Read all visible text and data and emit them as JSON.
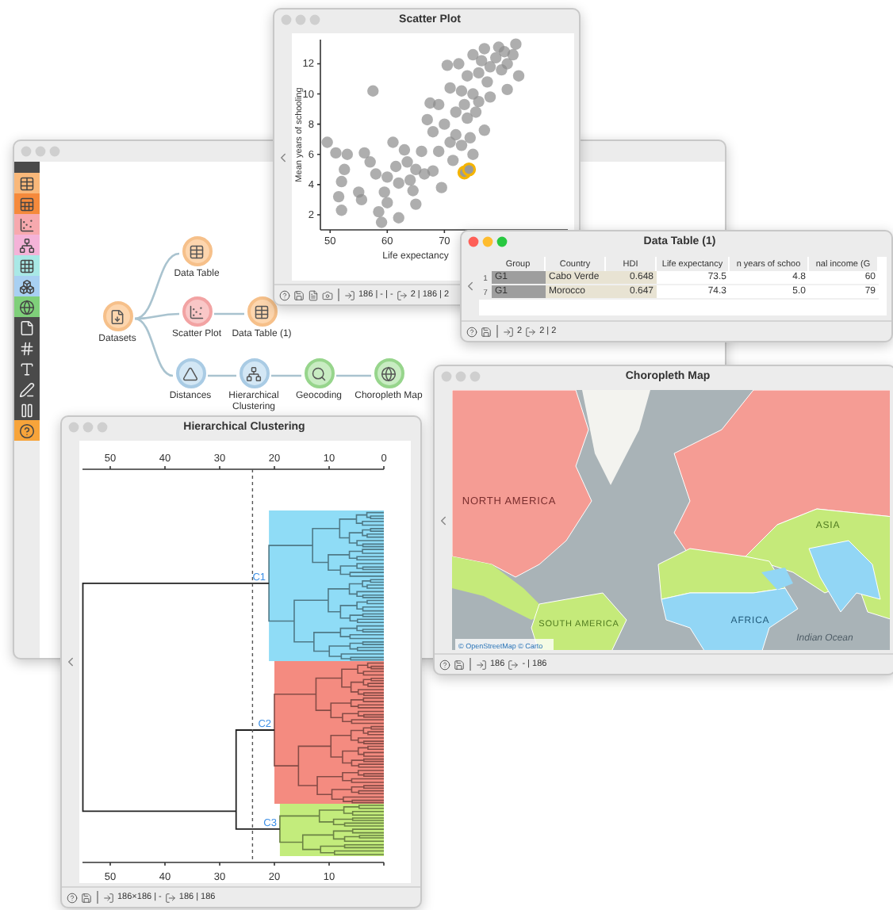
{
  "workflow": {
    "toolbar": [
      {
        "kind": "header"
      },
      {
        "kind": "table"
      },
      {
        "kind": "sheet"
      },
      {
        "kind": "scatter"
      },
      {
        "kind": "tree"
      },
      {
        "kind": "grid"
      },
      {
        "kind": "cluster"
      },
      {
        "kind": "globe"
      },
      {
        "kind": "file"
      },
      {
        "kind": "hash"
      },
      {
        "kind": "text"
      },
      {
        "kind": "pen"
      },
      {
        "kind": "pause"
      },
      {
        "kind": "help"
      }
    ],
    "nodes": [
      {
        "label": "Datasets",
        "kind": "file"
      },
      {
        "label": "Data Table",
        "kind": "table"
      },
      {
        "label": "Scatter Plot",
        "kind": "scatter"
      },
      {
        "label": "Data Table (1)",
        "kind": "table"
      },
      {
        "label": "Distances",
        "kind": "distance"
      },
      {
        "label": "Hierarchical Clustering",
        "kind": "hierarchy"
      },
      {
        "label": "Geocoding",
        "kind": "geocode"
      },
      {
        "label": "Choropleth Map",
        "kind": "map"
      }
    ]
  },
  "scatter_window": {
    "title": "Scatter Plot",
    "chart_data": {
      "type": "scatter",
      "xlabel": "Life expectancy",
      "ylabel": "Mean years of schooling",
      "xlim": [
        48.3,
        91.6
      ],
      "ylim": [
        1,
        13.6
      ],
      "xticks": [
        50,
        60,
        70
      ],
      "yticks": [
        2,
        4,
        6,
        8,
        10,
        12
      ],
      "x": [
        49.5,
        51,
        52.5,
        53,
        52,
        51.5,
        52,
        55,
        55.5,
        56,
        57,
        57.5,
        58,
        58.5,
        59,
        59.5,
        60,
        60,
        61,
        61.5,
        62,
        62,
        63,
        63.5,
        64,
        64.5,
        65,
        65,
        66,
        66.5,
        67,
        67.5,
        68,
        68,
        69,
        69,
        69.5,
        70,
        70.5,
        71,
        71,
        71.5,
        72,
        72,
        72.5,
        73,
        73,
        73.5,
        74,
        74,
        74.5,
        75,
        75,
        75.5,
        76,
        76,
        76.5,
        77,
        77.5,
        78,
        78,
        79,
        79.5,
        80,
        80.5,
        81,
        81,
        82,
        82.5,
        83,
        77,
        75,
        73.5,
        74.3
      ],
      "series": [
        {
          "color": "#8c8c8c",
          "values": [
            6.8,
            6.1,
            5,
            6,
            4.2,
            3.2,
            2.3,
            3.5,
            3,
            6.1,
            5.5,
            10.2,
            4.7,
            2.2,
            1.5,
            3.5,
            4.5,
            2.8,
            6.8,
            5.2,
            4.1,
            1.8,
            6.3,
            5.5,
            4.3,
            3.6,
            5,
            2.7,
            6.2,
            4.7,
            8.3,
            9.4,
            7.5,
            4.9,
            6.2,
            9.3,
            3.8,
            8,
            11.9,
            10.4,
            6.8,
            5.6,
            8.8,
            7.3,
            12,
            10.2,
            6.6,
            9.3,
            11.2,
            8.4,
            7.1,
            12.6,
            10,
            8.8,
            11.4,
            9.5,
            12.2,
            13,
            10.8,
            11.8,
            9.8,
            12.4,
            13.1,
            11.6,
            12.8,
            12,
            10.3,
            12.6,
            13.3,
            11.2,
            7.6,
            6,
            null,
            null
          ]
        },
        {
          "color": "#f5b400",
          "values": [
            null,
            null,
            null,
            null,
            null,
            null,
            null,
            null,
            null,
            null,
            null,
            null,
            null,
            null,
            null,
            null,
            null,
            null,
            null,
            null,
            null,
            null,
            null,
            null,
            null,
            null,
            null,
            null,
            null,
            null,
            null,
            null,
            null,
            null,
            null,
            null,
            null,
            null,
            null,
            null,
            null,
            null,
            null,
            null,
            null,
            null,
            null,
            null,
            null,
            null,
            null,
            null,
            null,
            null,
            null,
            null,
            null,
            null,
            null,
            null,
            null,
            null,
            null,
            null,
            null,
            null,
            null,
            null,
            null,
            null,
            null,
            null,
            4.8,
            5.0
          ]
        }
      ]
    },
    "status": [
      "186 | - | -",
      "2 | 186 | 2"
    ]
  },
  "table_window": {
    "title": "Data Table (1)",
    "columns": [
      "Group",
      "Country",
      "HDI",
      "Life expectancy",
      "n years of schoo",
      "nal income (G"
    ],
    "rows": [
      {
        "index": "1",
        "cells": [
          "G1",
          "Cabo Verde",
          "0.648",
          "73.5",
          "4.8",
          "60"
        ]
      },
      {
        "index": "7",
        "cells": [
          "G1",
          "Morocco",
          "0.647",
          "74.3",
          "5.0",
          "79"
        ]
      }
    ],
    "status": [
      "2",
      "2 | 2"
    ]
  },
  "map_window": {
    "title": "Choropleth Map",
    "labels": [
      "NORTH AMERICA",
      "ASIA",
      "AFRICA",
      "SOUTH AMERICA",
      "Indian Ocean"
    ],
    "attribution": "© OpenStreetMap © Carto",
    "status": [
      "186",
      "- | 186"
    ]
  },
  "clustering_window": {
    "title": "Hierarchical Clustering",
    "top_axis_ticks": [
      "50",
      "40",
      "30",
      "20",
      "10",
      "0"
    ],
    "bottom_axis_ticks": [
      "50",
      "40",
      "30",
      "20",
      "10"
    ],
    "clusters": [
      {
        "label": "C1",
        "color": "#8fdcf6"
      },
      {
        "label": "C2",
        "color": "#f48b80"
      },
      {
        "label": "C3",
        "color": "#c3ec7c"
      }
    ],
    "status": [
      "186×186 | -",
      "186 | 186"
    ]
  }
}
